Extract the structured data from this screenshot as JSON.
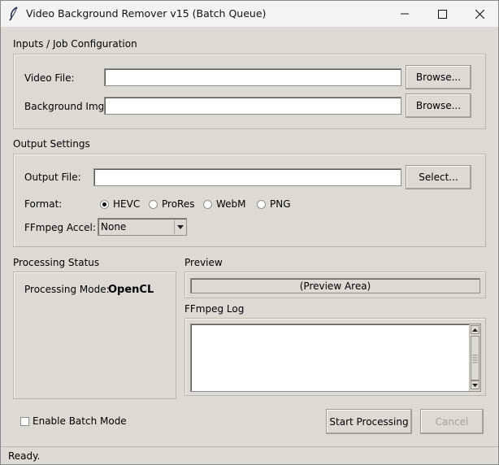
{
  "window": {
    "title": "Video Background Remover v15 (Batch Queue)",
    "icon": "feather-icon"
  },
  "inputs": {
    "section_label": "Inputs / Job Configuration",
    "video_label": "Video File:",
    "video_value": "",
    "video_browse": "Browse...",
    "bg_label": "Background Img:",
    "bg_value": "",
    "bg_browse": "Browse..."
  },
  "output": {
    "section_label": "Output Settings",
    "file_label": "Output File:",
    "file_value": "",
    "select_button": "Select...",
    "format_label": "Format:",
    "formats": [
      {
        "label": "HEVC",
        "selected": true
      },
      {
        "label": "ProRes",
        "selected": false
      },
      {
        "label": "WebM",
        "selected": false
      },
      {
        "label": "PNG",
        "selected": false
      }
    ],
    "accel_label": "FFmpeg Accel:",
    "accel_value": "None"
  },
  "status": {
    "section_label": "Processing Status",
    "mode_label": "Processing Mode:",
    "mode_value": "OpenCL"
  },
  "preview": {
    "section_label": "Preview",
    "area_label": "(Preview Area)"
  },
  "log": {
    "section_label": "FFmpeg Log",
    "content": ""
  },
  "controls": {
    "batch_label": "Enable Batch Mode",
    "batch_checked": false,
    "start_button": "Start Processing",
    "cancel_button": "Cancel",
    "cancel_enabled": false
  },
  "statusbar": {
    "text": "Ready."
  }
}
